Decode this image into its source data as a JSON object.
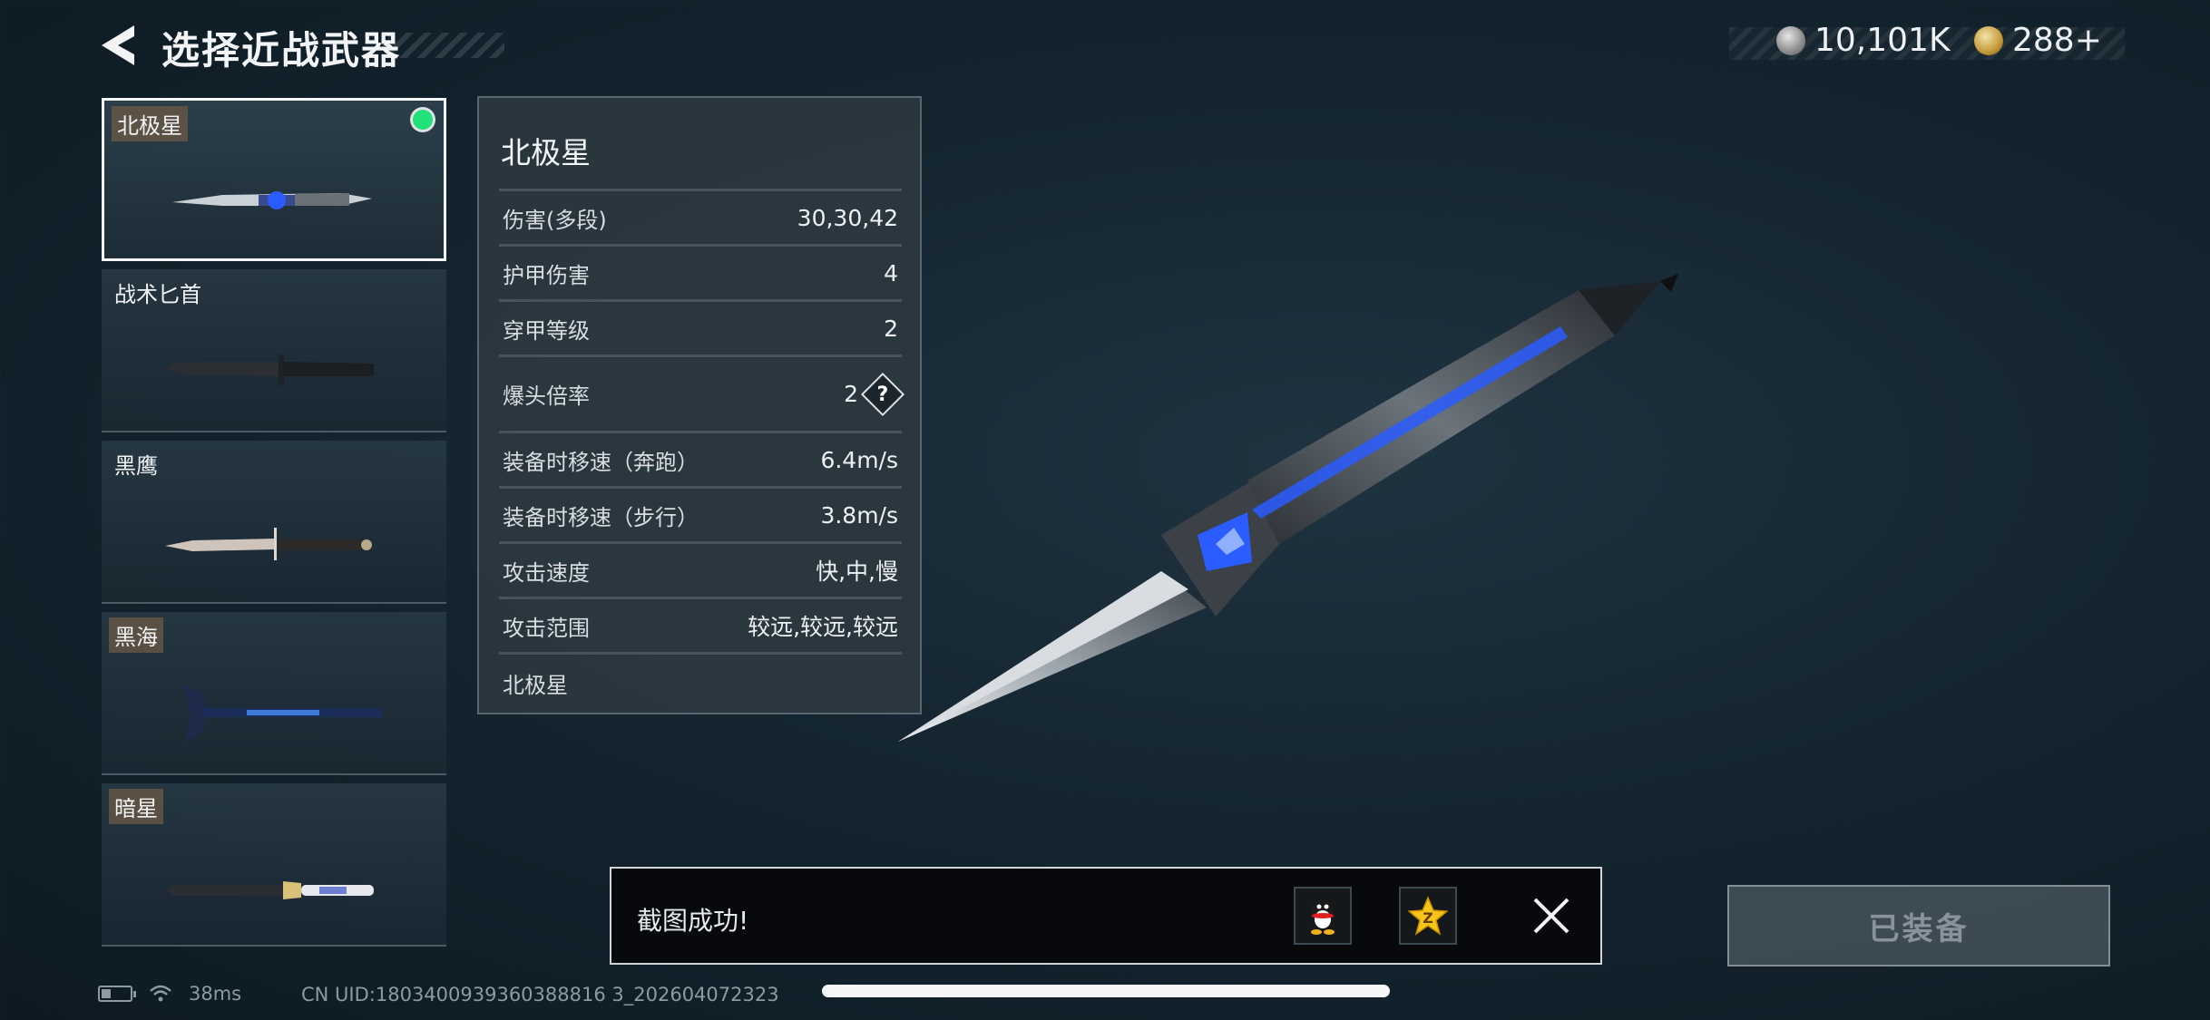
{
  "header": {
    "title": "选择近战武器",
    "currency": [
      {
        "icon": "silver-coin-icon",
        "value": "10,101K"
      },
      {
        "icon": "gold-coin-icon",
        "value": "288+"
      }
    ]
  },
  "weapons": [
    {
      "name": "北极星",
      "selected": true,
      "equipped": true,
      "tagged": true
    },
    {
      "name": "战术匕首",
      "selected": false,
      "equipped": false,
      "tagged": false
    },
    {
      "name": "黑鹰",
      "selected": false,
      "equipped": false,
      "tagged": false
    },
    {
      "name": "黑海",
      "selected": false,
      "equipped": false,
      "tagged": true
    },
    {
      "name": "暗星",
      "selected": false,
      "equipped": false,
      "tagged": true
    }
  ],
  "stats": {
    "title": "北极星",
    "rows": [
      {
        "label": "伤害(多段)",
        "value": "30,30,42"
      },
      {
        "label": "护甲伤害",
        "value": "4"
      },
      {
        "label": "穿甲等级",
        "value": "2"
      },
      {
        "label": "爆头倍率",
        "value": "2",
        "help": "?"
      },
      {
        "label": "装备时移速（奔跑）",
        "value": "6.4m/s"
      },
      {
        "label": "装备时移速（步行）",
        "value": "3.8m/s"
      },
      {
        "label": "攻击速度",
        "value": "快,中,慢"
      },
      {
        "label": "攻击范围",
        "value": "较远,较远,较远"
      },
      {
        "label": "北极星",
        "value": ""
      }
    ]
  },
  "toast": {
    "message": "截图成功!",
    "share_buttons": [
      "qq-icon",
      "qzone-icon"
    ]
  },
  "equip_button": {
    "label": "已装备"
  },
  "status": {
    "ping": "38ms",
    "uid": "CN UID:1803400939360388816 3_202604072323"
  },
  "colors": {
    "equipped_dot": "#22e07a",
    "accent_blue": "#2a5cff"
  }
}
